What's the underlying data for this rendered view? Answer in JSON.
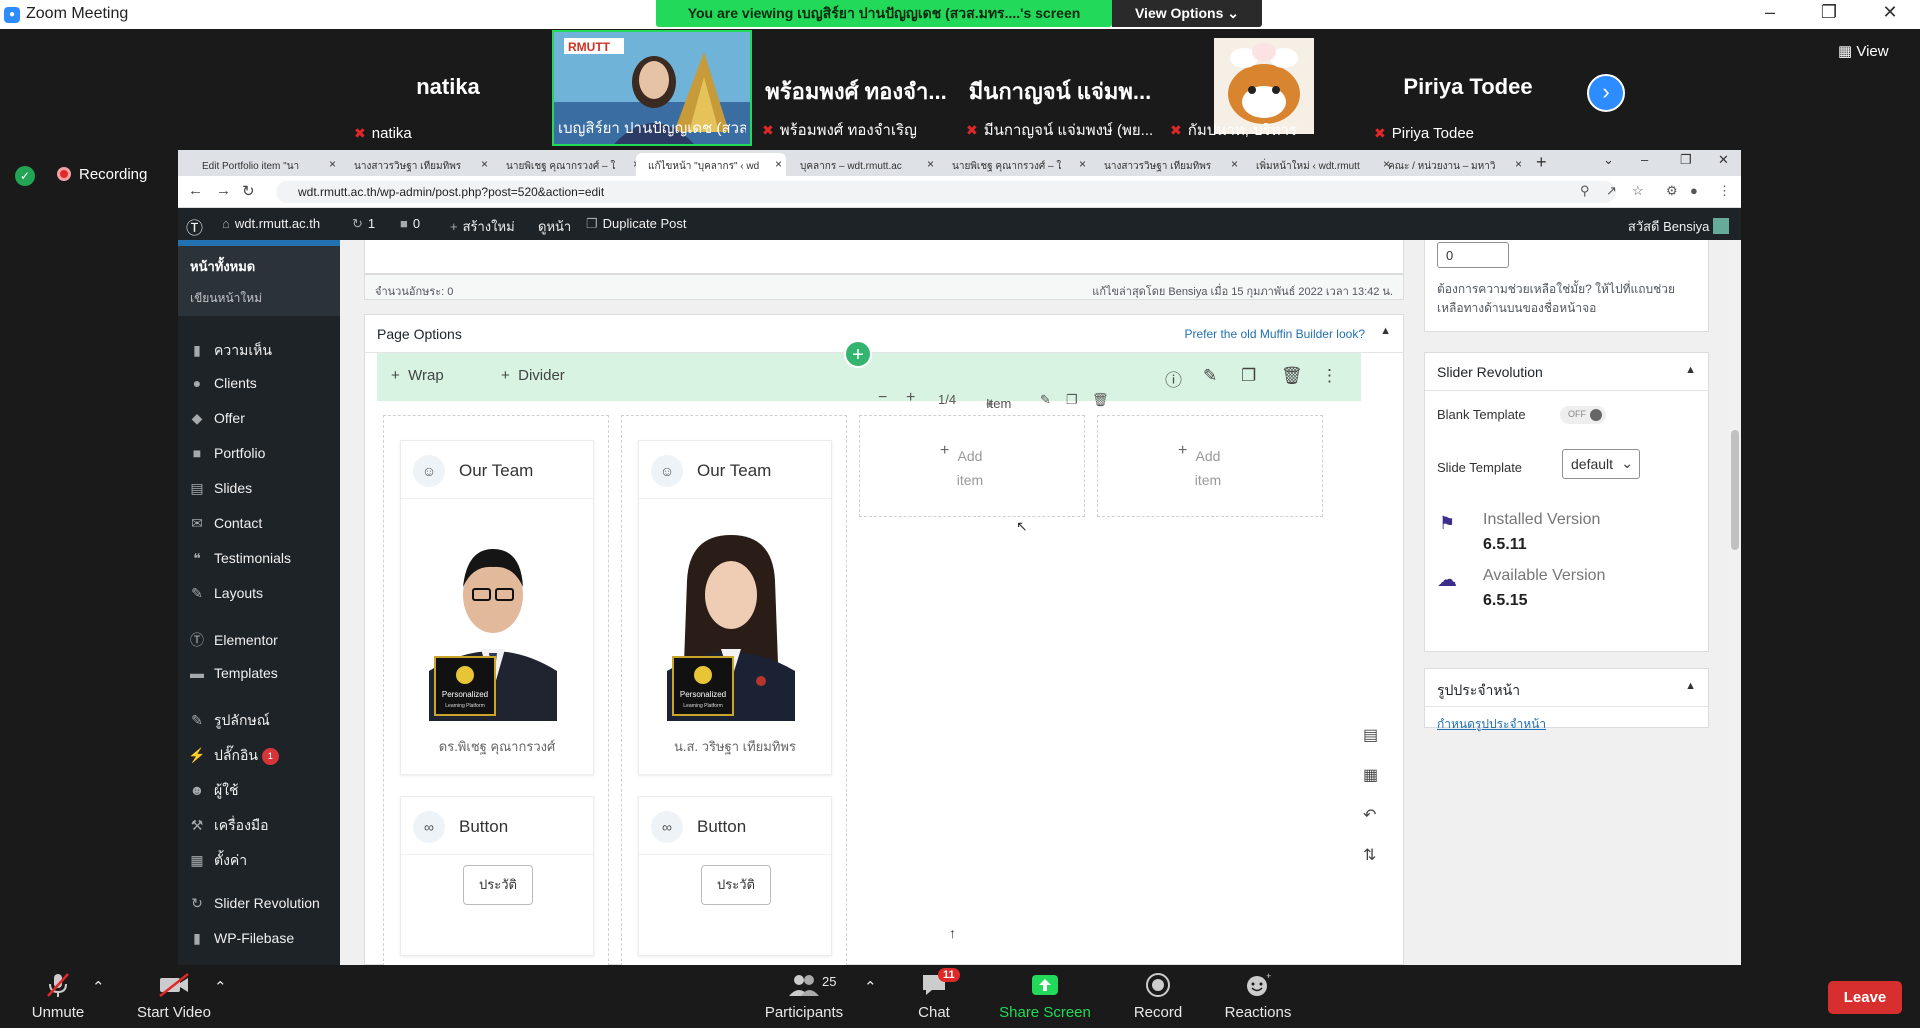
{
  "zoom": {
    "title": "Zoom Meeting",
    "share_banner": "You are viewing เบญสิร์ยา ปานปัญญเดช (สวส.มทร....'s screen",
    "view_options": "View Options",
    "view_label": "View",
    "recording": "Recording",
    "participants": [
      {
        "big": "natika",
        "name": "natika"
      },
      {
        "big": "",
        "name": "เบญสิร์ยา ปานปัญญเดช (สวส..."
      },
      {
        "big": "พร้อมพงศ์ ทองจำ...",
        "name": "พร้อมพงศ์ ทองจำเริญ"
      },
      {
        "big": "มีนกาญจน์ แจ่มพ...",
        "name": "มีนกาญจน์ แจ่มพงษ์ (พย..."
      },
      {
        "big": "",
        "name": "กัมปนาท, บริหาร"
      },
      {
        "big": "Piriya Todee",
        "name": "Piriya Todee"
      }
    ],
    "controls": {
      "unmute": "Unmute",
      "start_video": "Start Video",
      "participants": "Participants",
      "participants_count": "25",
      "chat": "Chat",
      "chat_badge": "11",
      "share_screen": "Share Screen",
      "record": "Record",
      "reactions": "Reactions",
      "leave": "Leave"
    }
  },
  "browser": {
    "tabs": [
      "Edit Portfolio item \"นา",
      "นางสาวรวิษฐา เทียมทิพร",
      "นายพิเชฐ คุณากรวงศ์ – ใ",
      "แก้ไขหน้า \"บุคลากร\" ‹ wd",
      "บุคลากร – wdt.rmutt.ac",
      "นายพิเชฐ คุณากรวงศ์ – ใ",
      "นางสาวรวิษฐา เทียมทิพร",
      "เพิ่มหน้าใหม่ ‹ wdt.rmutt",
      "คณะ / หน่วยงาน – มหาวิ"
    ],
    "url": "wdt.rmutt.ac.th/wp-admin/post.php?post=520&action=edit"
  },
  "admin_bar": {
    "site": "wdt.rmutt.ac.th",
    "updates": "1",
    "comments": "0",
    "new": "สร้างใหม่",
    "view": "ดูหน้า",
    "duplicate": "Duplicate Post",
    "greeting": "สวัสดี Bensiya"
  },
  "sidebar": {
    "sub_all": "หน้าทั้งหมด",
    "sub_new": "เขียนหน้าใหม่",
    "items": [
      {
        "icon": "comment-icon",
        "label": "ความเห็น"
      },
      {
        "icon": "clients-icon",
        "label": "Clients"
      },
      {
        "icon": "offer-icon",
        "label": "Offer"
      },
      {
        "icon": "portfolio-icon",
        "label": "Portfolio"
      },
      {
        "icon": "slides-icon",
        "label": "Slides"
      },
      {
        "icon": "contact-icon",
        "label": "Contact"
      },
      {
        "icon": "testimonials-icon",
        "label": "Testimonials"
      },
      {
        "icon": "layouts-icon",
        "label": "Layouts"
      },
      {
        "icon": "elementor-icon",
        "label": "Elementor"
      },
      {
        "icon": "templates-icon",
        "label": "Templates"
      },
      {
        "icon": "appearance-icon",
        "label": "รูปลักษณ์"
      },
      {
        "icon": "plugins-icon",
        "label": "ปลั๊กอิน",
        "badge": "1"
      },
      {
        "icon": "users-icon",
        "label": "ผู้ใช้"
      },
      {
        "icon": "tools-icon",
        "label": "เครื่องมือ"
      },
      {
        "icon": "settings-icon",
        "label": "ตั้งค่า"
      },
      {
        "icon": "slider-revolution-icon",
        "label": "Slider Revolution"
      },
      {
        "icon": "filebase-icon",
        "label": "WP-Filebase"
      }
    ]
  },
  "editor": {
    "word_count": "จำนวนอักษระ: 0",
    "last_edited": "แก้ไขล่าสุดโดย Bensiya เมื่อ 15 กุมภาพันธ์ 2022 เวลา 13:42 น."
  },
  "page_options": {
    "title": "Page Options",
    "old_builder_link": "Prefer the old Muffin Builder look?",
    "wrap": "Wrap",
    "divider": "Divider",
    "item_size": "1/4",
    "item_btn": "Item",
    "add_item_line1": "Add",
    "add_item_line2": "item",
    "columns": [
      {
        "card_title": "Our Team",
        "caption": "ดร.พิเชฐ คุณากรวงศ์",
        "button_card_title": "Button",
        "button_label": "ประวัติ"
      },
      {
        "card_title": "Our Team",
        "caption": "น.ส. วริษฐา เทียมทิพร",
        "button_card_title": "Button",
        "button_label": "ประวัติ"
      }
    ],
    "badge_text_1": "Personalized",
    "badge_text_2": "Learning Platform"
  },
  "right_panel": {
    "order_value": "0",
    "help_text": "ต้องการความช่วยเหลือใช่มั้ย? ให้ไปที่แถบช่วยเหลือทางด้านบนของชื่อหน้าจอ",
    "slider_title": "Slider Revolution",
    "blank_template": "Blank Template",
    "toggle_off": "OFF",
    "slide_template": "Slide Template",
    "slide_template_value": "default",
    "installed_label": "Installed Version",
    "installed_version": "6.5.11",
    "available_label": "Available Version",
    "available_version": "6.5.15",
    "featured_title": "รูปประจำหน้า",
    "featured_link": "กำหนดรูปประจำหน้า"
  },
  "colors": {
    "zoom_green": "#23d959",
    "zoom_blue": "#2d8cff",
    "wp_dark": "#1d2327",
    "wp_blue": "#2271b1",
    "leave_red": "#d72e2e"
  }
}
